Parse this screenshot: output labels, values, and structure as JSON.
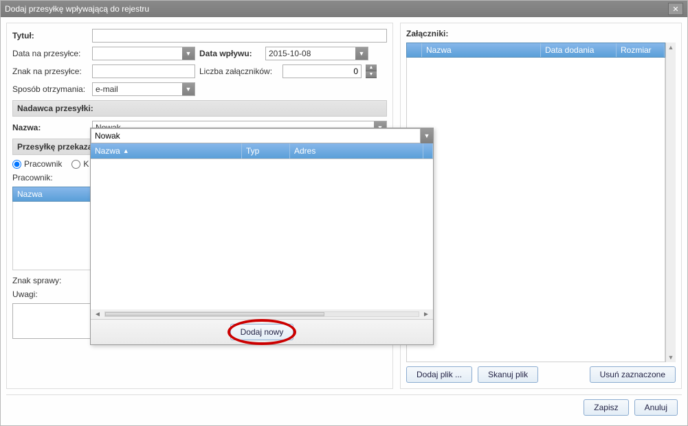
{
  "window": {
    "title": "Dodaj przesyłkę wpływającą do rejestru"
  },
  "form": {
    "title_label": "Tytuł:",
    "title_value": "",
    "date_on_label": "Data na przesyłce:",
    "date_on_value": "",
    "date_in_label": "Data wpływu:",
    "date_in_value": "2015-10-08",
    "sign_on_label": "Znak na przesyłce:",
    "sign_on_value": "",
    "att_count_label": "Liczba załączników:",
    "att_count_value": "0",
    "receive_label": "Sposób otrzymania:",
    "receive_value": "e-mail"
  },
  "sender": {
    "section": "Nadawca przesyłki:",
    "name_label": "Nazwa:",
    "name_value": "Nowak"
  },
  "forward": {
    "section": "Przesyłkę przekaza",
    "radio_employee": "Pracownik",
    "radio_k": "K",
    "employee_label": "Pracownik:",
    "grid_col_name": "Nazwa"
  },
  "matter": {
    "sign_label": "Znak sprawy:",
    "notes_label": "Uwagi:"
  },
  "attachments": {
    "header": "Załączniki:",
    "col_name": "Nazwa",
    "col_date": "Data dodania",
    "col_size": "Rozmiar",
    "btn_add_file": "Dodaj plik ...",
    "btn_scan": "Skanuj plik",
    "btn_remove": "Usuń zaznaczone"
  },
  "buttons": {
    "save": "Zapisz",
    "cancel": "Anuluj"
  },
  "popup": {
    "search_value": "Nowak",
    "col_name": "Nazwa",
    "col_type": "Typ",
    "col_address": "Adres",
    "btn_add_new": "Dodaj nowy"
  }
}
